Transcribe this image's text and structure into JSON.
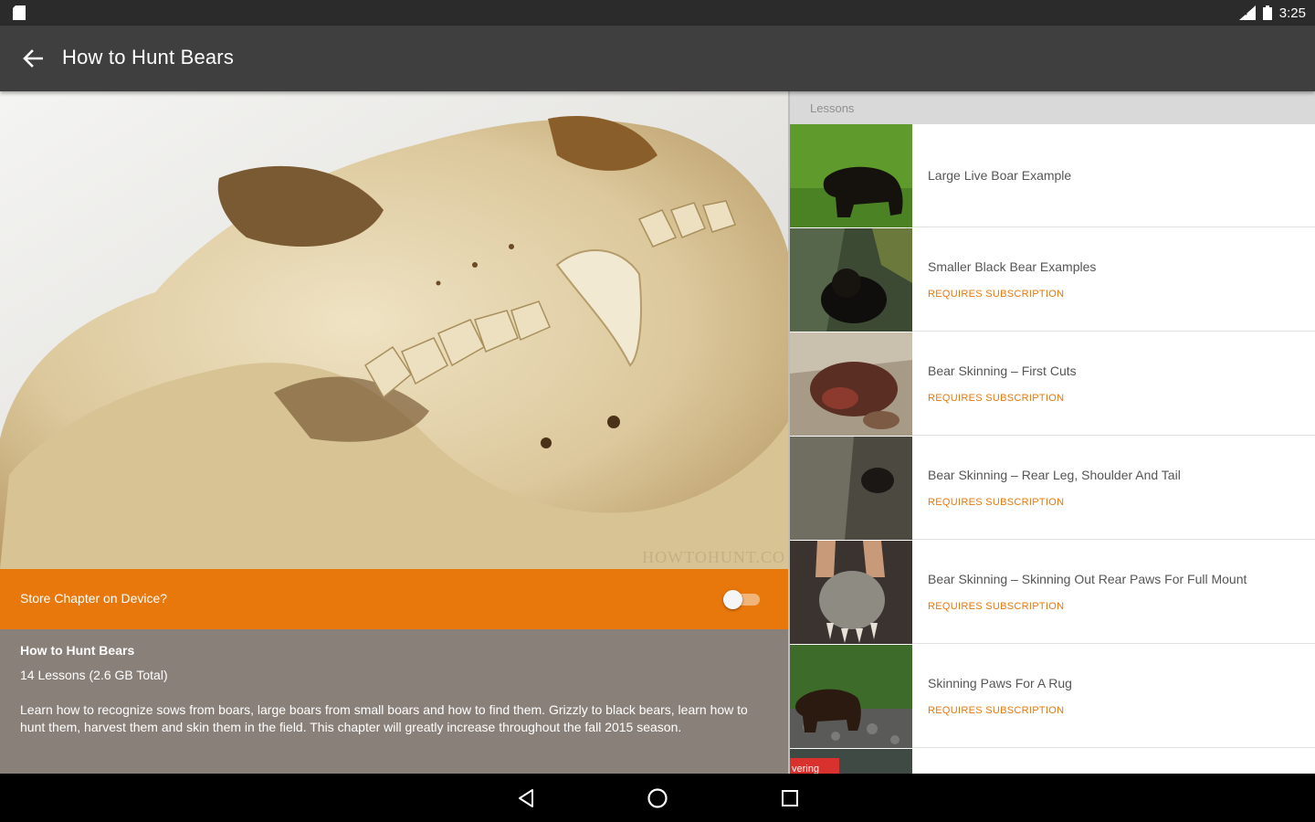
{
  "status_bar": {
    "time": "3:25"
  },
  "app_bar": {
    "title": "How to Hunt Bears",
    "back_icon": "arrow-back-icon"
  },
  "hero": {
    "image": "bear-skull-photo",
    "watermark": "HOWTOHUNT.CO"
  },
  "store_option": {
    "label": "Store Chapter on Device?",
    "enabled": false
  },
  "chapter": {
    "title": "How to Hunt Bears",
    "meta": "14 Lessons (2.6 GB Total)",
    "description": "Learn how to recognize sows from boars, large boars from small boars and how to find them. Grizzly to black bears, learn how to hunt them, harvest them and skin them in the field. This chapter will greatly increase throughout the fall 2015 season."
  },
  "lessons": {
    "header": "Lessons",
    "items": [
      {
        "title": "Large Live Boar Example",
        "requirement": ""
      },
      {
        "title": "Smaller Black Bear Examples",
        "requirement": "REQUIRES SUBSCRIPTION"
      },
      {
        "title": "Bear Skinning – First Cuts",
        "requirement": "REQUIRES SUBSCRIPTION"
      },
      {
        "title": "Bear Skinning – Rear Leg, Shoulder And Tail",
        "requirement": "REQUIRES SUBSCRIPTION"
      },
      {
        "title": "Bear Skinning – Skinning Out Rear Paws For Full Mount",
        "requirement": "REQUIRES SUBSCRIPTION"
      },
      {
        "title": "Skinning Paws For A Rug",
        "requirement": "REQUIRES SUBSCRIPTION"
      },
      {
        "title": "",
        "requirement": "",
        "thumb_badge": "vering"
      }
    ]
  },
  "nav_bar": {
    "back": "nav-back-icon",
    "home": "nav-home-icon",
    "recents": "nav-recents-icon"
  },
  "colors": {
    "accent": "#e8780c",
    "app_bar": "#3f3f3f",
    "info_bg": "#8a807a"
  }
}
